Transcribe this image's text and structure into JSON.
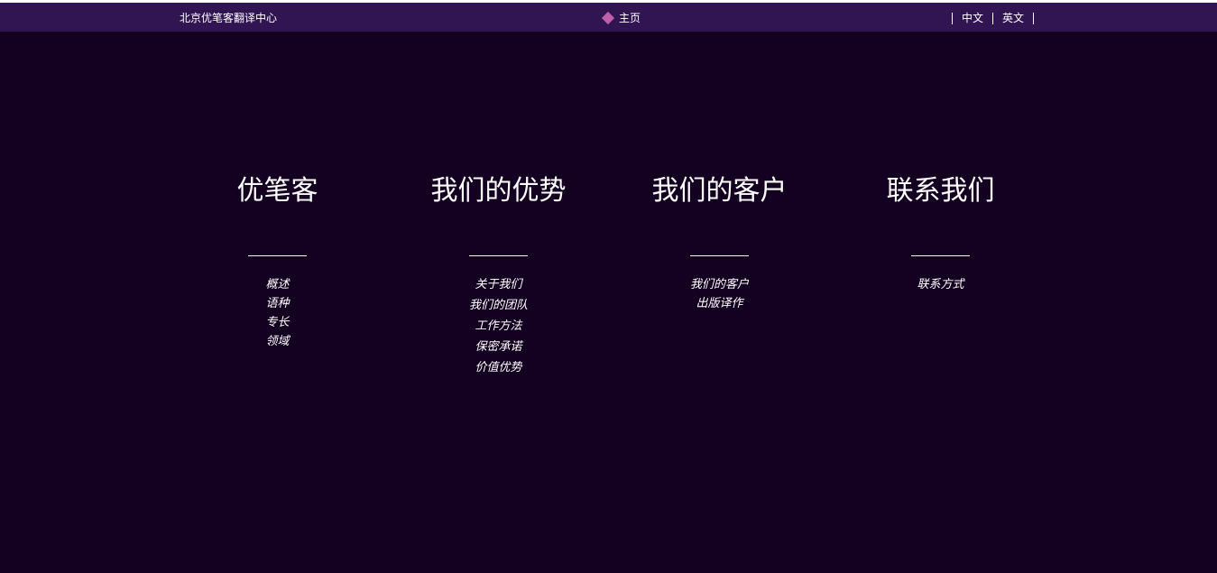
{
  "header": {
    "site_name": "北京优笔客翻译中心",
    "home_label": "主页",
    "languages": [
      "中文",
      "英文"
    ]
  },
  "columns": [
    {
      "title": "优笔客",
      "links": [
        "概述",
        "语种",
        "专长",
        "领域"
      ]
    },
    {
      "title": "我们的优势",
      "links": [
        "关于我们",
        "我们的团队",
        "工作方法",
        "保密承诺",
        "价值优势"
      ]
    },
    {
      "title": "我们的客户",
      "links": [
        "我们的客户",
        "出版译作"
      ]
    },
    {
      "title": "联系我们",
      "links": [
        "联系方式"
      ]
    }
  ],
  "colors": {
    "page_background": "#140020",
    "header_background": "#311452",
    "home_diamond": "#c060a8",
    "text": "#ffffff"
  },
  "icons": {
    "home": "diamond-icon"
  }
}
